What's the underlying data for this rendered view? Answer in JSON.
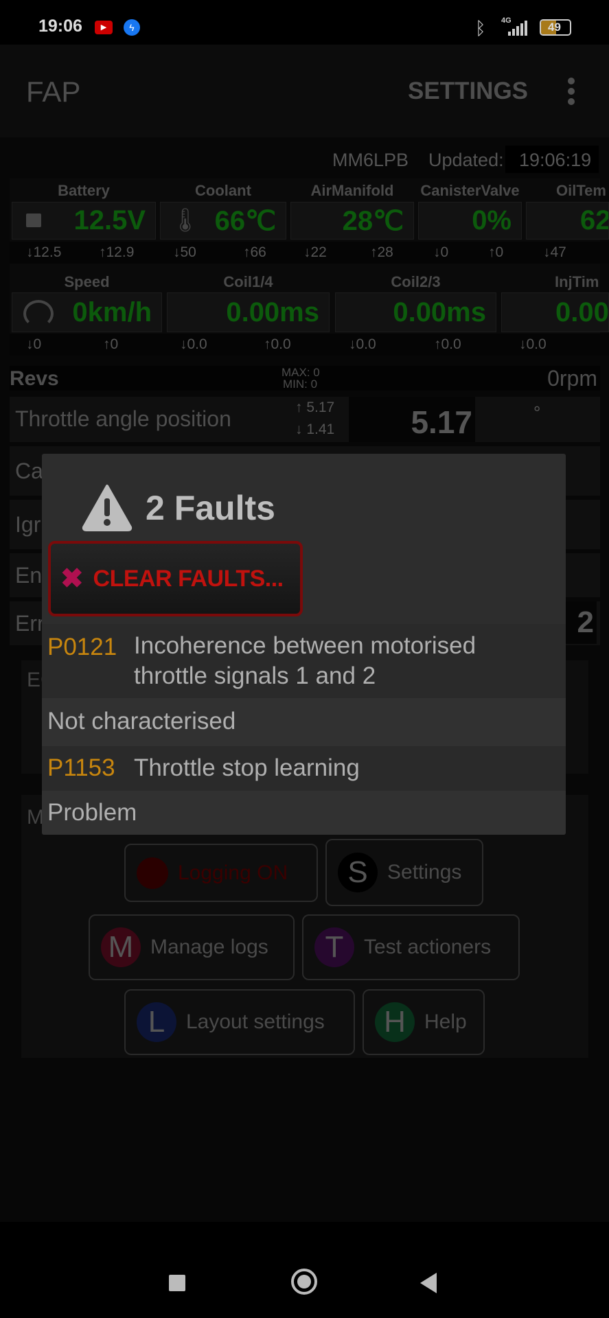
{
  "status_bar": {
    "time": "19:06",
    "notifications": [
      "youtube-icon",
      "messenger-icon"
    ],
    "network": "4G",
    "battery": "49"
  },
  "app_bar": {
    "title": "FAP",
    "settings_label": "SETTINGS",
    "menu_icon": "more-vert-icon"
  },
  "info": {
    "vehicle": "MM6LPB",
    "updated_label": "Updated:",
    "updated_time": "19:06:19"
  },
  "gauges_row1": [
    {
      "label": "Battery",
      "value": "12.5V",
      "min": "12.5",
      "max": "12.9",
      "icon": "battery-icon"
    },
    {
      "label": "Coolant",
      "value": "66℃",
      "min": "50",
      "max": "66",
      "icon": "thermometer-icon"
    },
    {
      "label": "AirManifold",
      "value": "28℃",
      "min": "22",
      "max": "28"
    },
    {
      "label": "CanisterValve",
      "value": "0%",
      "min": "0",
      "max": "0"
    },
    {
      "label": "OilTem",
      "value": "62",
      "min": "47",
      "max": ""
    }
  ],
  "gauges_row2": [
    {
      "label": "Speed",
      "value": "0km/h",
      "min": "0",
      "max": "0",
      "icon": "speedometer-icon"
    },
    {
      "label": "Coil1/4",
      "value": "0.00ms",
      "min": "0.0",
      "max": "0.0"
    },
    {
      "label": "Coil2/3",
      "value": "0.00ms",
      "min": "0.0",
      "max": "0.0"
    },
    {
      "label": "InjTim",
      "value": "0.00",
      "min": "0.0",
      "max": ""
    }
  ],
  "revs": {
    "label": "Revs",
    "max": "MAX: 0",
    "min": "MIN: 0",
    "value": "0rpm"
  },
  "rows": [
    {
      "label": "Throttle angle position",
      "max": "5.17",
      "min": "1.41",
      "value": "5.17",
      "unit": "°"
    },
    {
      "label": "Ca"
    },
    {
      "label": "Igr"
    },
    {
      "label": "En"
    },
    {
      "label": "Err",
      "value": "2"
    }
  ],
  "cards": {
    "ecu_label": "EC",
    "menu_label": "M"
  },
  "buttons": {
    "logging": "Logging  ON",
    "settings": "Settings",
    "settings_letter": "S",
    "manage_logs": "Manage logs",
    "manage_letter": "M",
    "test": "Test actioners",
    "test_letter": "T",
    "layout": "Layout settings",
    "layout_letter": "L",
    "help": "Help",
    "help_letter": "H"
  },
  "dialog": {
    "title": "2 Faults",
    "clear_label": "CLEAR FAULTS...",
    "faults": [
      {
        "code": "P0121",
        "description": "Incoherence between motorised throttle signals 1 and 2",
        "status": "Not characterised"
      },
      {
        "code": "P1153",
        "description": "Throttle stop learning",
        "status": "Problem"
      }
    ]
  },
  "colors": {
    "gauge_value": "#0c5a0c",
    "fault_code": "#c8860e",
    "clear_red": "#c0120e",
    "dialog_bg": "#2d2d2d"
  }
}
